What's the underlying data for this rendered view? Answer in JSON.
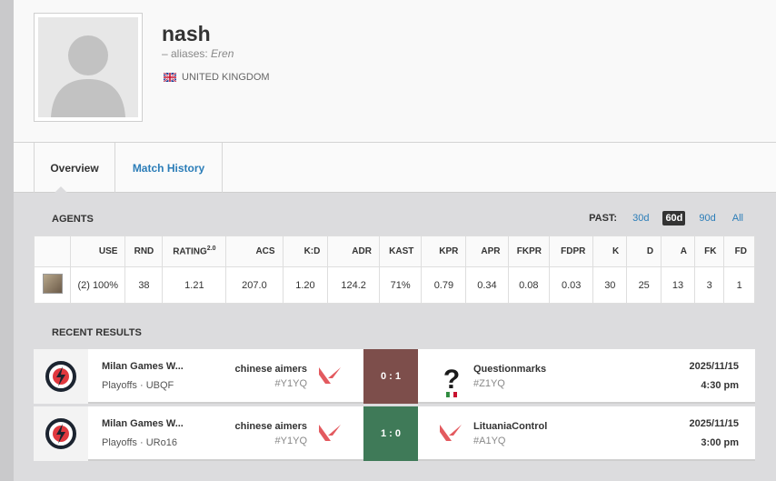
{
  "player": {
    "name": "nash",
    "aliases_prefix": "– aliases:",
    "alias": "Eren",
    "country": "UNITED KINGDOM"
  },
  "tabs": [
    {
      "label": "Overview",
      "active": true
    },
    {
      "label": "Match History",
      "active": false
    }
  ],
  "agents_section": {
    "title": "AGENTS",
    "past_label": "PAST:",
    "periods": [
      "30d",
      "60d",
      "90d",
      "All"
    ],
    "active_period": "60d",
    "columns": [
      "",
      "USE",
      "RND",
      "RATING",
      "ACS",
      "K:D",
      "ADR",
      "KAST",
      "KPR",
      "APR",
      "FKPR",
      "FDPR",
      "K",
      "D",
      "A",
      "FK",
      "FD"
    ],
    "rating_sup": "2.0",
    "rows": [
      [
        "(2) 100%",
        "38",
        "1.21",
        "207.0",
        "1.20",
        "124.2",
        "71%",
        "0.79",
        "0.34",
        "0.08",
        "0.03",
        "30",
        "25",
        "13",
        "3",
        "1"
      ]
    ]
  },
  "results_section": {
    "title": "RECENT RESULTS",
    "matches": [
      {
        "event": "Milan Games W...",
        "stage": "Playoffs · UBQF",
        "team1": "chinese aimers",
        "team1_tag": "#Y1YQ",
        "score": "0 : 1",
        "result": "loss",
        "team2": "Questionmarks",
        "team2_tag": "#Z1YQ",
        "date": "2025/11/15",
        "time": "4:30 pm"
      },
      {
        "event": "Milan Games W...",
        "stage": "Playoffs · URo16",
        "team1": "chinese aimers",
        "team1_tag": "#Y1YQ",
        "score": "1 : 0",
        "result": "win",
        "team2": "LituaniaControl",
        "team2_tag": "#A1YQ",
        "date": "2025/11/15",
        "time": "3:00 pm"
      }
    ]
  },
  "colors": {
    "link": "#2b7db8",
    "loss": "#7d4e4b",
    "win": "#3f7a58",
    "valorant": "#e35a5f"
  }
}
